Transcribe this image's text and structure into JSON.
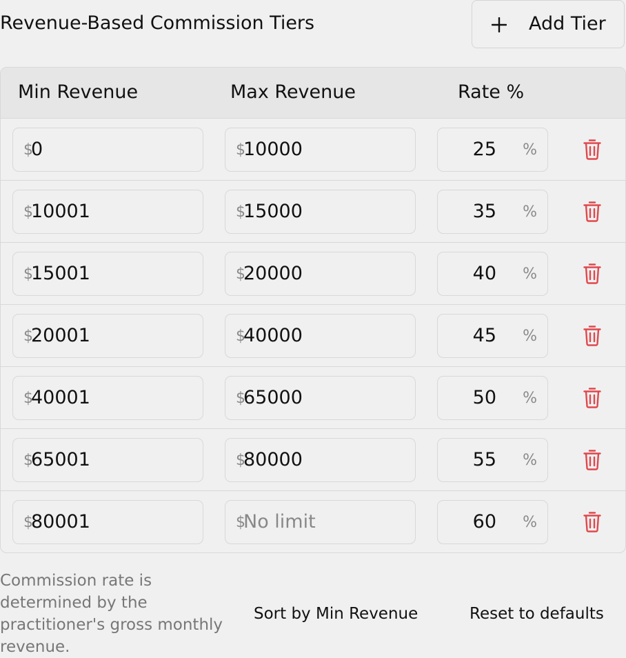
{
  "header": {
    "title": "Revenue-Based Commission Tiers",
    "add_button_label": "Add Tier",
    "add_icon": "plus-icon"
  },
  "table": {
    "columns": {
      "min": "Min Revenue",
      "max": "Max Revenue",
      "rate": "Rate %"
    },
    "currency_symbol": "$",
    "percent_symbol": "%",
    "delete_icon": "trash-icon",
    "delete_color": "#e0474c",
    "rows": [
      {
        "min": "0",
        "max": "10000",
        "max_placeholder": "",
        "rate": "25"
      },
      {
        "min": "10001",
        "max": "15000",
        "max_placeholder": "",
        "rate": "35"
      },
      {
        "min": "15001",
        "max": "20000",
        "max_placeholder": "",
        "rate": "40"
      },
      {
        "min": "20001",
        "max": "40000",
        "max_placeholder": "",
        "rate": "45"
      },
      {
        "min": "40001",
        "max": "65000",
        "max_placeholder": "",
        "rate": "50"
      },
      {
        "min": "65001",
        "max": "80000",
        "max_placeholder": "",
        "rate": "55"
      },
      {
        "min": "80001",
        "max": "",
        "max_placeholder": "No limit",
        "rate": "60"
      }
    ]
  },
  "footer": {
    "note": "Commission rate is determined by the practitioner's gross monthly revenue.",
    "sort_label": "Sort by Min Revenue",
    "reset_label": "Reset to defaults"
  }
}
